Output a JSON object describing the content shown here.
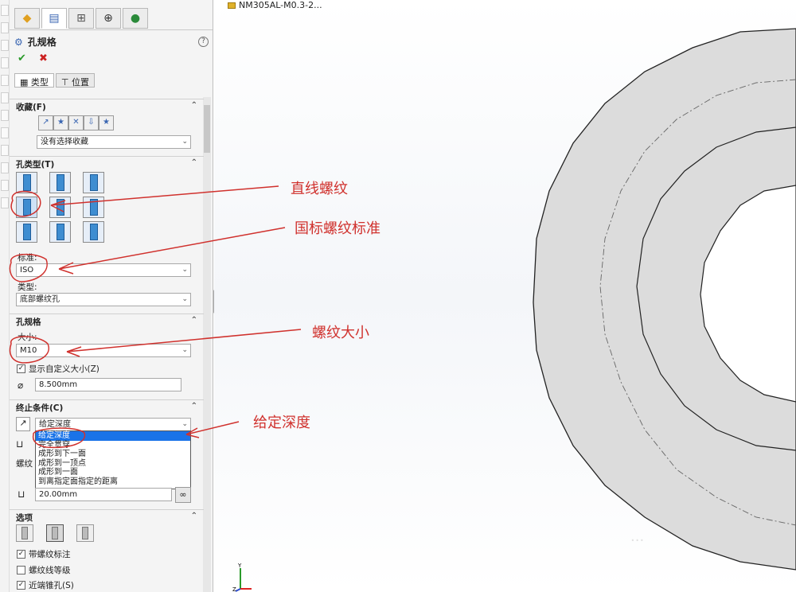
{
  "window": {
    "doc_title": "NM305AL-M0.3-2..."
  },
  "panel": {
    "title": "孔规格",
    "tabs": [
      {
        "label": "类型"
      },
      {
        "label": "位置"
      }
    ],
    "favorites": {
      "section_label": "收藏(F)",
      "dropdown_value": "没有选择收藏"
    },
    "hole_type": {
      "section_label": "孔类型(T)",
      "standard_label": "标准:",
      "standard_value": "ISO",
      "type_label": "类型:",
      "type_value": "底部螺纹孔"
    },
    "hole_spec": {
      "section_label": "孔规格",
      "size_label": "大小:",
      "size_value": "M10",
      "custom_size_label": "显示自定义大小(Z)",
      "custom_size_checked": true,
      "diameter_value": "8.500mm"
    },
    "end_condition": {
      "section_label": "终止条件(C)",
      "selected_value": "给定深度",
      "options": [
        "给定深度",
        "完全贯穿",
        "成形到下一面",
        "成形到一顶点",
        "成形到一面",
        "到离指定面指定的距离"
      ],
      "thread_label": "螺纹",
      "thread_depth_value": "20.00mm"
    },
    "options": {
      "section_label": "选项",
      "with_thread_callout_label": "带螺纹标注",
      "with_thread_callout_checked": true,
      "thread_class_label": "螺纹线等级",
      "thread_class_checked": false,
      "near_side_countersink_label": "近端锥孔(S)",
      "near_side_countersink_checked": true
    }
  },
  "annotations": {
    "straight_thread": "直线螺纹",
    "gb_thread_standard": "国标螺纹标准",
    "thread_size": "螺纹大小",
    "given_depth": "给定深度"
  },
  "triad": {
    "y_label": "Y",
    "z_label": "Z"
  },
  "watermark": "...",
  "colors": {
    "annotation": "#d0312d",
    "part_face": "#dcdcdc",
    "selection": "#1a73e8"
  }
}
